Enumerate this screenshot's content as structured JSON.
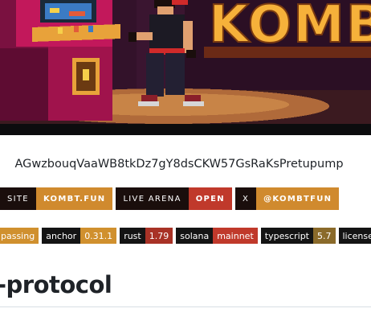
{
  "banner": {
    "image_name": "pixel-art-arcade-fighter-banner",
    "title_fragment": "KOMB",
    "colors": {
      "wall": "#3a1530",
      "arcade_cabinet": "#c2185b",
      "floor": "#b06a3a",
      "title": "#f6b13a"
    }
  },
  "address": "AGwzbouqVaaWB8tkDz7gY8dsCKW57GsRaKsPretupump",
  "link_badges": [
    {
      "label": "SITE",
      "value": "KOMBT.FUN",
      "value_color": "#d08a2e"
    },
    {
      "label": "LIVE ARENA",
      "value": "OPEN",
      "value_color": "#c0392b"
    },
    {
      "label": "X",
      "value": "@KOMBTFUN",
      "value_color": "#d08a2e"
    }
  ],
  "shields": [
    {
      "label": "",
      "value": "passing",
      "value_color": "#d0902e"
    },
    {
      "label": "anchor",
      "value": "0.31.1",
      "value_color": "#d0902e"
    },
    {
      "label": "rust",
      "value": "1.79",
      "value_color": "#a83226"
    },
    {
      "label": "solana",
      "value": "mainnet",
      "value_color": "#c0392b"
    },
    {
      "label": "typescript",
      "value": "5.7",
      "value_color": "#8a6a2a"
    },
    {
      "label": "license",
      "value": "",
      "value_color": "#141414"
    }
  ],
  "heading": "-protocol"
}
